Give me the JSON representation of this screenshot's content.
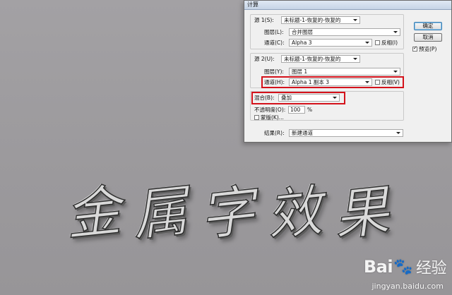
{
  "dialog": {
    "title": "计算",
    "source1": {
      "label": "源 1(S):",
      "value": "未标题-1-恢复的-恢复的",
      "layer_label": "图层(L):",
      "layer_value": "合并图层",
      "channel_label": "通道(C):",
      "channel_value": "Alpha 3",
      "invert_label": "反相(I)",
      "invert_checked": false
    },
    "source2": {
      "label": "源 2(U):",
      "value": "未标题-1-恢复的-恢复的",
      "layer_label": "图层(Y):",
      "layer_value": "图层 1",
      "channel_label": "通道(H):",
      "channel_value": "Alpha 1 副本 3",
      "invert_label": "反相(V)",
      "invert_checked": false
    },
    "blending": {
      "label": "混合(B):",
      "value": "叠加",
      "opacity_label": "不透明度(O):",
      "opacity_value": "100",
      "opacity_unit": "%",
      "mask_label": "蒙版(K)...",
      "mask_checked": false
    },
    "result": {
      "label": "结果(R):",
      "value": "新建通道"
    },
    "buttons": {
      "ok": "确定",
      "cancel": "取消"
    },
    "preview": {
      "label": "预览(P)",
      "checked": true
    }
  },
  "artwork": {
    "chars": [
      "金",
      "属",
      "字",
      "效",
      "果"
    ]
  },
  "watermark": {
    "brand_left": "Bai",
    "brand_right": "经验",
    "url": "jingyan.baidu.com"
  },
  "colors": {
    "highlight": "#d4121b",
    "canvas": "#9d9b9e",
    "dialog_bg": "#f0f0f0"
  }
}
